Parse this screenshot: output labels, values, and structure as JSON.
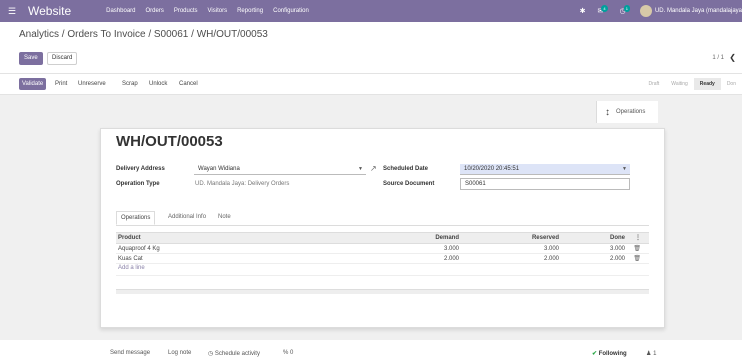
{
  "navbar": {
    "app_name": "Website",
    "menu": [
      "Dashboard",
      "Orders",
      "Products",
      "Visitors",
      "Reporting",
      "Configuration"
    ],
    "activity_count": "4",
    "message_count": "1",
    "user": "UD. Mandala Jaya (mandalajaya"
  },
  "breadcrumb": {
    "parts": [
      "Analytics",
      "Orders To Invoice",
      "S00061",
      "WH/OUT/00053"
    ]
  },
  "buttons": {
    "save": "Save",
    "discard": "Discard"
  },
  "pager": "1 / 1",
  "statusbar": {
    "actions": [
      "Validate",
      "Print",
      "Unreserve",
      "Scrap",
      "Unlock",
      "Cancel"
    ],
    "stages": [
      "Draft",
      "Waiting",
      "Ready",
      "Don"
    ],
    "active_stage": "Ready"
  },
  "smart_button": {
    "label": "Operations"
  },
  "record": {
    "name": "WH/OUT/00053",
    "delivery_address_label": "Delivery Address",
    "delivery_address": "Wayan Widiana",
    "operation_type_label": "Operation Type",
    "operation_type": "UD. Mandala Jaya: Delivery Orders",
    "scheduled_date_label": "Scheduled Date",
    "scheduled_date": "10/20/2020 20:45:51",
    "source_document_label": "Source Document",
    "source_document": "S00061"
  },
  "tabs": [
    "Operations",
    "Additional Info",
    "Note"
  ],
  "table": {
    "headers": [
      "Product",
      "Demand",
      "Reserved",
      "Done"
    ],
    "rows": [
      {
        "product": "Aquaproof 4 Kg",
        "demand": "3.000",
        "reserved": "3.000",
        "done": "3.000"
      },
      {
        "product": "Kuas Cat",
        "demand": "2.000",
        "reserved": "2.000",
        "done": "2.000"
      }
    ],
    "add_line": "Add a line"
  },
  "chatter": {
    "send_message": "Send message",
    "log_note": "Log note",
    "schedule_activity": "Schedule activity",
    "attachments": "0",
    "following": "Following",
    "followers": "1"
  },
  "colors": {
    "brand": "#7c6f9f",
    "highlight_field": "#dde4f7",
    "following_check": "#28a745"
  }
}
